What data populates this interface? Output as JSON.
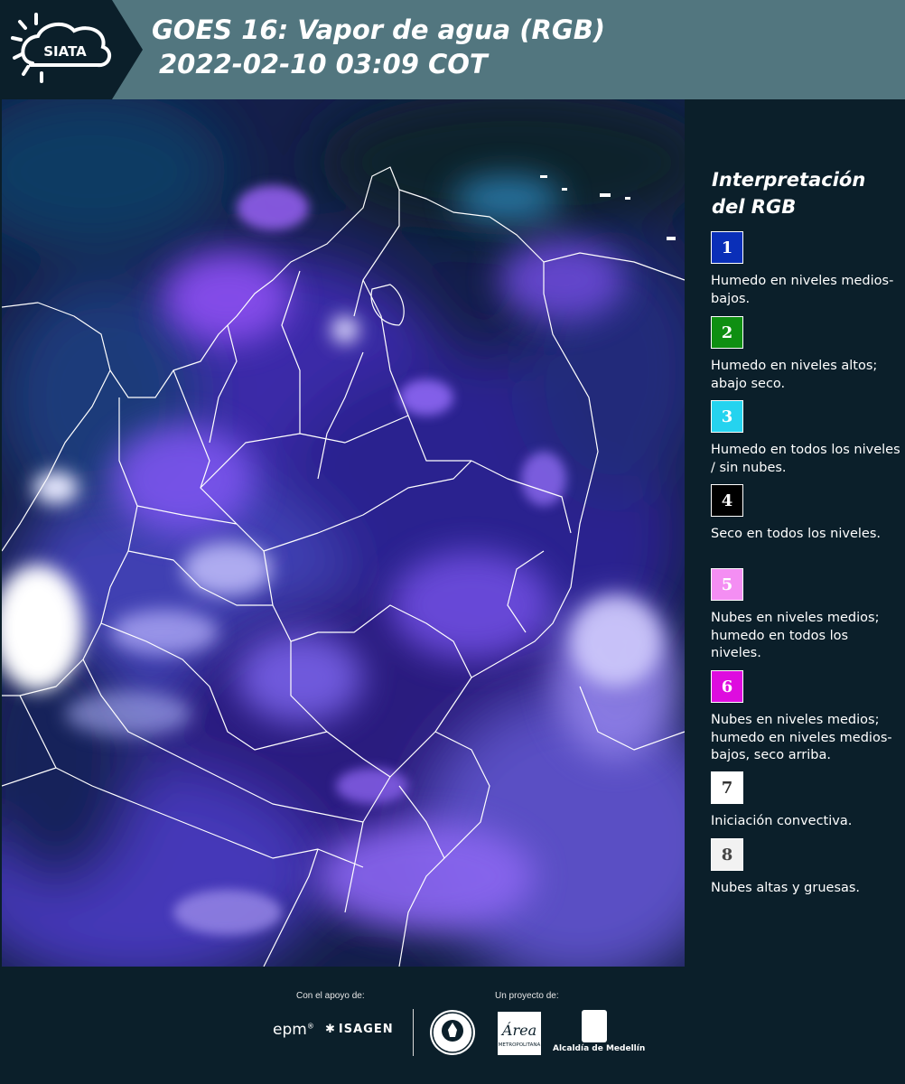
{
  "header": {
    "logo_text": "SIATA",
    "title_line1": "GOES 16: Vapor de agua (RGB)",
    "title_line2": "2022-02-10 03:09 COT"
  },
  "legend": {
    "title": "Interpretación del RGB",
    "items": [
      {
        "number": "1",
        "color": "#0a2fb8",
        "text_color": "#ffffff",
        "text": "Humedo en niveles medios-bajos."
      },
      {
        "number": "2",
        "color": "#0f8f12",
        "text_color": "#ffffff",
        "text": "Humedo en niveles altos; abajo seco."
      },
      {
        "number": "3",
        "color": "#25d3ef",
        "text_color": "#ffffff",
        "text": "Humedo en todos los niveles / sin nubes."
      },
      {
        "number": "4",
        "color": "#000000",
        "text_color": "#ffffff",
        "text": "Seco en todos los niveles."
      },
      {
        "number": "5",
        "color": "#f48ef3",
        "text_color": "#ffffff",
        "text": "Nubes en niveles medios; humedo en todos los niveles."
      },
      {
        "number": "6",
        "color": "#de0cdf",
        "text_color": "#ffffff",
        "text": "Nubes en niveles medios; humedo en niveles medios-bajos, seco arriba."
      },
      {
        "number": "7",
        "color": "#ffffff",
        "text_color": "#333333",
        "text": "Iniciación convectiva."
      },
      {
        "number": "8",
        "color": "#f2f2f2",
        "text_color": "#444444",
        "text": "Nubes altas y gruesas."
      }
    ]
  },
  "footer": {
    "support_label": "Con el apoyo de:",
    "project_label": "Un proyecto de:",
    "epm": "epm",
    "isagen": "ISAGEN",
    "area_text": "Área",
    "area_sub": "METROPOLITANA",
    "alcaldia": "Alcaldía de Medellín"
  }
}
